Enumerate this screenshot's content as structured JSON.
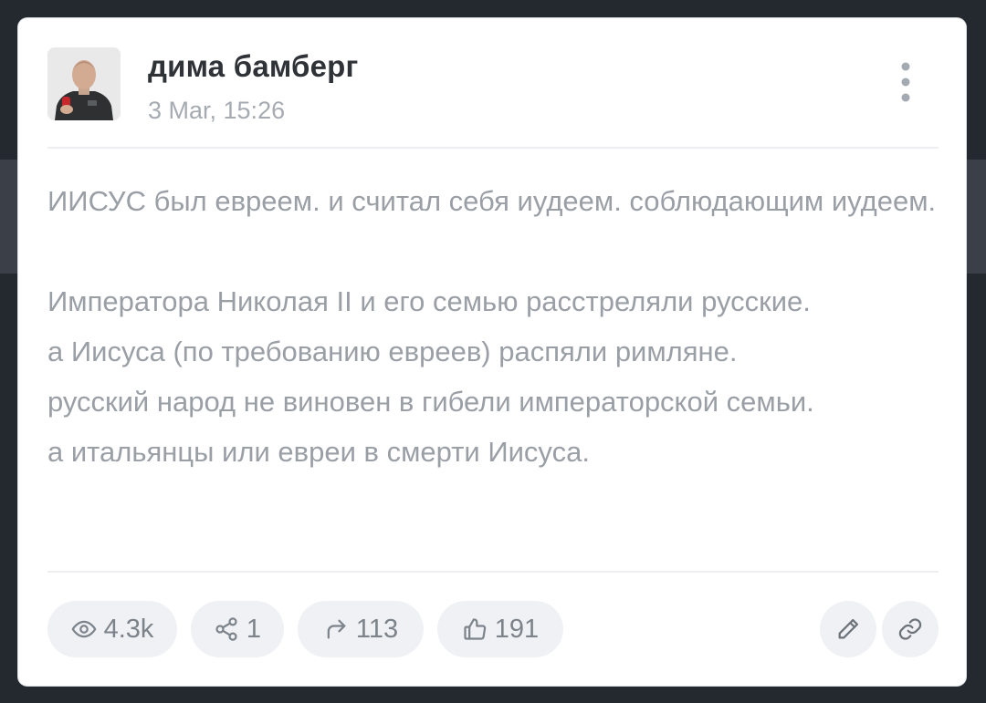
{
  "post": {
    "author": "дима бамберг",
    "date": "3 Mar, 15:26",
    "paragraphs": [
      "ИИСУС был евреем. и считал себя иудеем. соблюдающим иудеем.",
      "Императора Николая II и его семью расстреляли русские.\nа Иисуса (по требованию евреев) распяли римляне.\nрусский народ не виновен в гибели императорской семьи.\nа итальянцы или евреи в смерти Иисуса."
    ]
  },
  "stats": {
    "views": "4.3k",
    "shares": "1",
    "forwards": "113",
    "likes": "191"
  },
  "icons": {
    "more": "more-vertical-icon",
    "views": "eye-icon",
    "shares": "share-nodes-icon",
    "forwards": "forward-arrow-icon",
    "likes": "thumbs-up-icon",
    "edit": "pencil-icon",
    "link": "link-icon"
  },
  "colors": {
    "background": "#24292f",
    "card": "#ffffff",
    "author_text": "#2f3338",
    "muted_text": "#9a9fa6",
    "pill_bg": "#eff1f4",
    "icon": "#7d838b"
  }
}
